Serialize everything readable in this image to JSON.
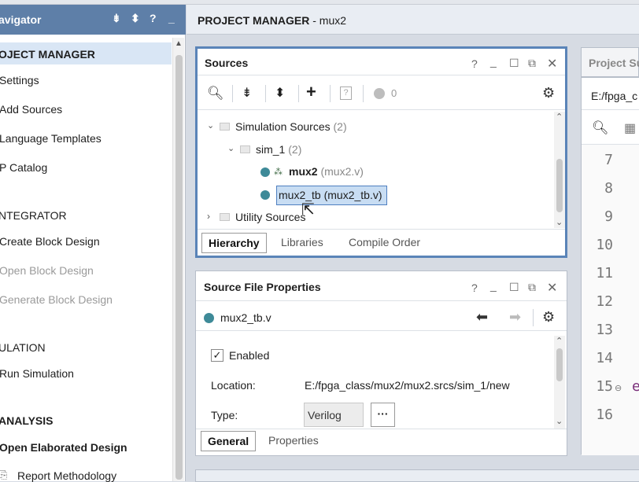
{
  "navigator": {
    "title": "avigator",
    "sections": [
      {
        "label": "OJECT MANAGER",
        "items": [
          "Settings",
          "Add Sources",
          "Language Templates",
          "P Catalog"
        ]
      },
      {
        "label": "NTEGRATOR",
        "items": [
          "Create Block Design",
          "Open Block Design",
          "Generate Block Design"
        ]
      },
      {
        "label": "ULATION",
        "items": [
          "Run Simulation"
        ]
      },
      {
        "label": "ANALYSIS",
        "items": [
          "Open Elaborated Design",
          "Report Methodology"
        ]
      }
    ],
    "header_icons": [
      "collapse-all-icon",
      "expand-icon",
      "help-icon",
      "minimize-icon"
    ]
  },
  "project_manager": {
    "title": "PROJECT MANAGER",
    "project": " - mux2"
  },
  "sources": {
    "title": "Sources",
    "badge_count": "0",
    "tree": {
      "simulation_sources": {
        "label": "Simulation Sources",
        "count": "(2)"
      },
      "sim_1": {
        "label": "sim_1",
        "count": "(2)"
      },
      "mux2": {
        "label": "mux2",
        "file": "(mux2.v)"
      },
      "mux2_tb": {
        "label": "mux2_tb",
        "file": "(mux2_tb.v)"
      },
      "utility_sources": {
        "label": "Utility Sources"
      }
    },
    "tabs": [
      "Hierarchy",
      "Libraries",
      "Compile Order"
    ],
    "active_tab": "Hierarchy"
  },
  "file_properties": {
    "title": "Source File Properties",
    "file_name": "mux2_tb.v",
    "enabled_label": "Enabled",
    "enabled": true,
    "location_label": "Location:",
    "location_value": "E:/fpga_class/mux2/mux2.srcs/sim_1/new",
    "type_label": "Type:",
    "type_value": "Verilog",
    "more_button": "···",
    "tabs": [
      "General",
      "Properties"
    ],
    "active_tab": "General"
  },
  "project_summary": {
    "title": "Project Su",
    "path": "E:/fpga_c",
    "line_numbers": [
      "7",
      "8",
      "9",
      "10",
      "11",
      "12",
      "13",
      "14",
      "15",
      "16"
    ],
    "line15_text": "e"
  },
  "colors": {
    "nav_header": "#5e7fa8",
    "selection": "#c8ddf3",
    "active_border": "#5a84b8",
    "source_dot": "#3e8a98"
  }
}
